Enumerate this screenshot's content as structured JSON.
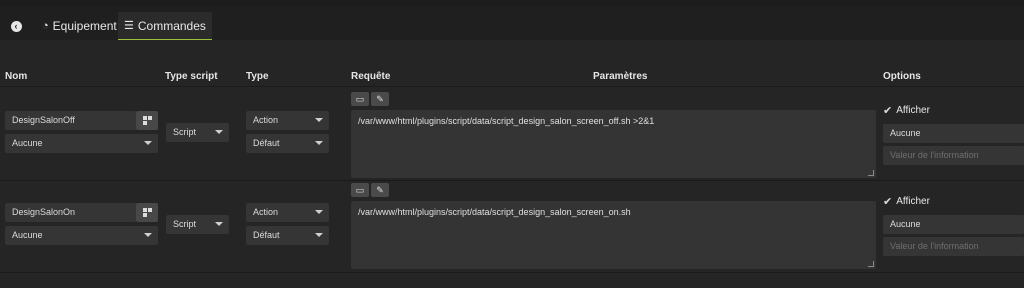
{
  "tabs": {
    "equipement": "Equipement",
    "commandes": "Commandes"
  },
  "headers": {
    "nom": "Nom",
    "type_script": "Type script",
    "type": "Type",
    "requete": "Requête",
    "parametres": "Paramètres",
    "options": "Options"
  },
  "rows": [
    {
      "name": "DesignSalonOff",
      "name_sub": "Aucune",
      "type_script": "Script",
      "type": "Action",
      "subtype": "Défaut",
      "request": "/var/www/html/plugins/script/data/script_design_salon_screen_off.sh >2&1",
      "afficher": "Afficher",
      "info_select": "Aucune",
      "info_placeholder": "Valeur de l'information"
    },
    {
      "name": "DesignSalonOn",
      "name_sub": "Aucune",
      "type_script": "Script",
      "type": "Action",
      "subtype": "Défaut",
      "request": "/var/www/html/plugins/script/data/script_design_salon_screen_on.sh",
      "afficher": "Afficher",
      "info_select": "Aucune",
      "info_placeholder": "Valeur de l'information"
    }
  ],
  "icons": {
    "back": "circle-arrow-left-icon",
    "equipement": "tachometer-icon",
    "commandes": "list-icon",
    "qr": "qrcode-icon",
    "folder": "folder-open-icon",
    "edit": "edit-icon",
    "check": "checkmark-icon"
  },
  "colors": {
    "accent": "#9bc23c",
    "background": "#252525",
    "field": "#353535"
  }
}
